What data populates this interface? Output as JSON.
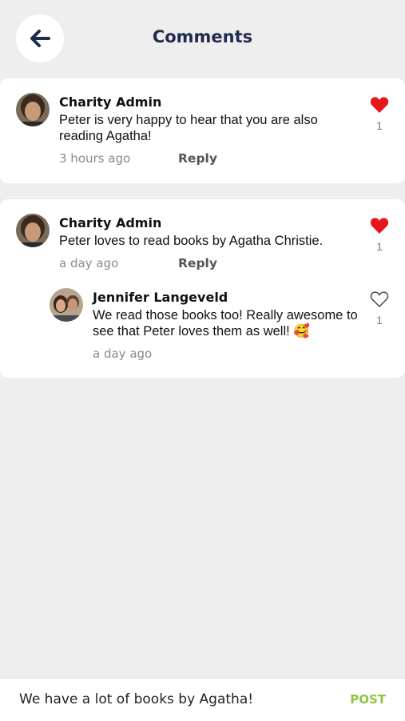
{
  "header": {
    "title": "Comments",
    "back_icon": "arrow-left-icon"
  },
  "comments": [
    {
      "author": "Charity Admin",
      "text": "Peter is very happy to hear that you are also reading Agatha!",
      "time": "3 hours ago",
      "reply_label": "Reply",
      "likes": "1",
      "liked": true
    },
    {
      "author": "Charity Admin",
      "text": "Peter loves to read books by Agatha Christie.",
      "time": "a day ago",
      "reply_label": "Reply",
      "likes": "1",
      "liked": true,
      "replies": [
        {
          "author": "Jennifer Langeveld",
          "text": "We read those books too! Really awesome to see that Peter loves them as well!",
          "emoji": "🥰",
          "time": "a day ago",
          "likes": "1",
          "liked": false
        }
      ]
    }
  ],
  "composer": {
    "value": "We have a lot of books by Agatha!",
    "post_label": "POST"
  },
  "colors": {
    "heart_liked": "#e8151b",
    "post_accent": "#8cc63f",
    "title": "#1f2a4d"
  }
}
